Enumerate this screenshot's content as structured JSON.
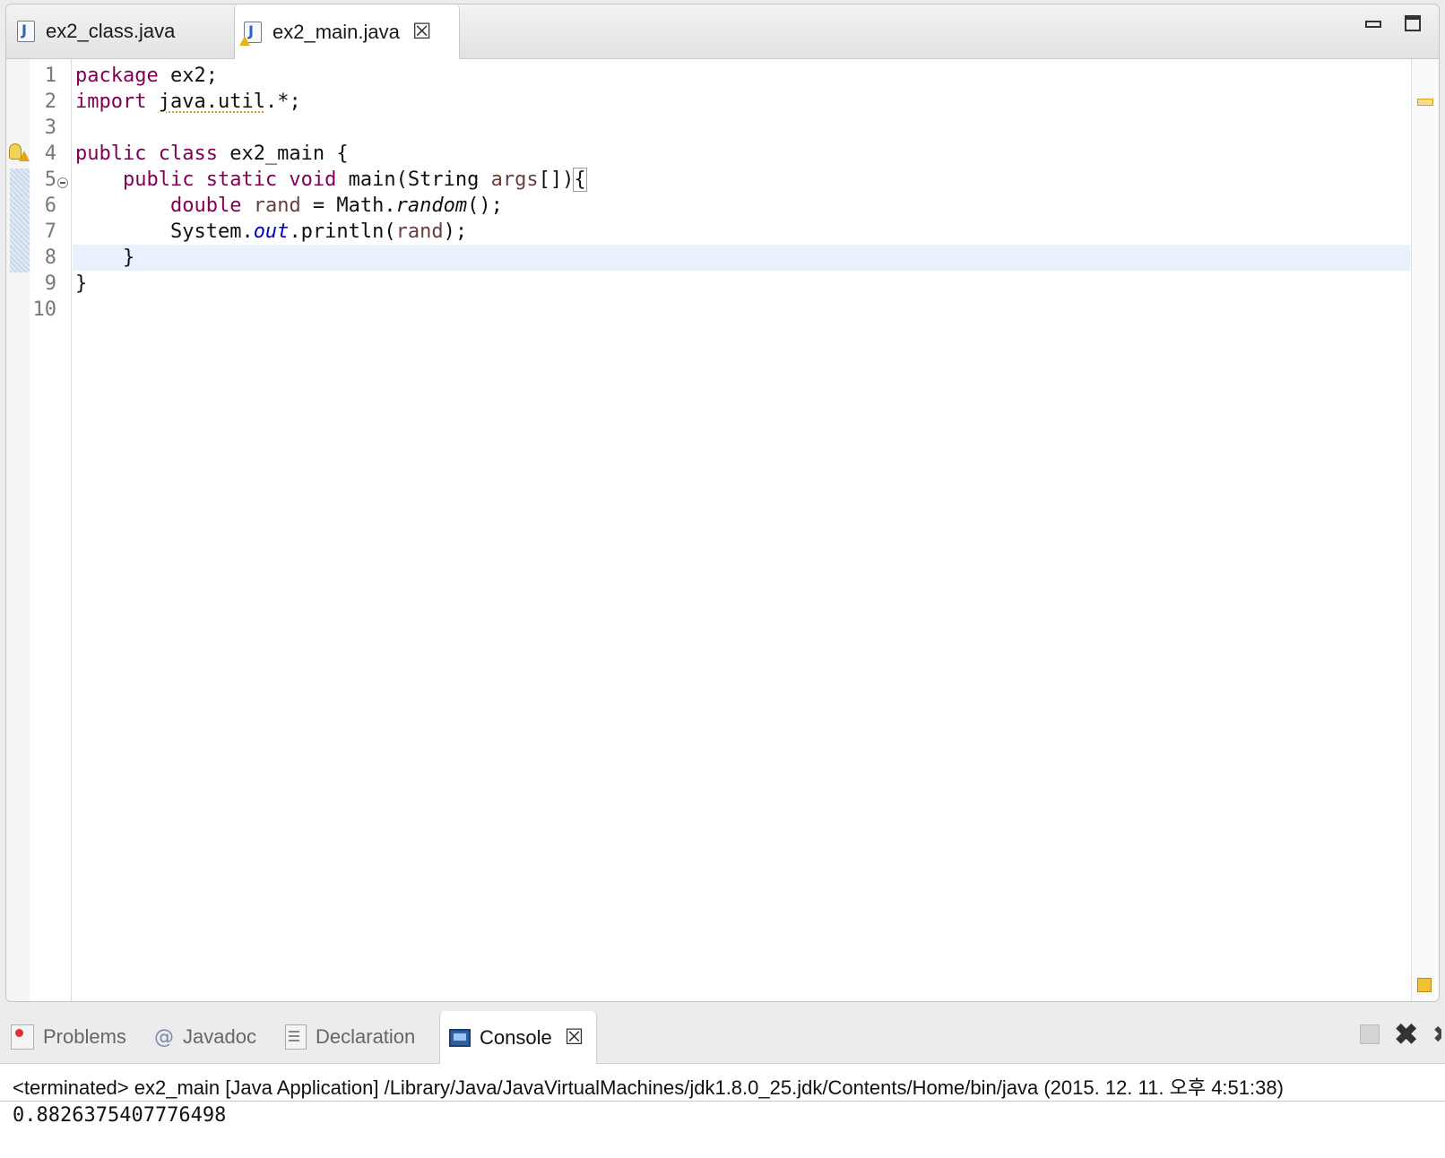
{
  "editor": {
    "tabs": [
      {
        "label": "ex2_class.java",
        "active": false
      },
      {
        "label": "ex2_main.java",
        "active": true,
        "has_warning": true
      }
    ],
    "close_glyph": "☒",
    "line_numbers": [
      "1",
      "2",
      "3",
      "4",
      "5",
      "6",
      "7",
      "8",
      "9",
      "10"
    ],
    "current_line": 8
  },
  "code": {
    "l1_kw": "package",
    "l1_rest": " ex2;",
    "l2_kw": "import",
    "l2_pkg": "java.util",
    "l2_rest": ".*;",
    "l4_kw": "public class",
    "l4_rest": " ex2_main {",
    "l5_indent": "    ",
    "l5_kw": "public static void",
    "l5_mid": " main(String ",
    "l5_var": "args",
    "l5_rest": "[])",
    "l5_brace": "{",
    "l6_indent": "        ",
    "l6_kw": "double",
    "l6_sp": " ",
    "l6_var": "rand",
    "l6_mid": " = Math.",
    "l6_method": "random",
    "l6_rest": "();",
    "l7_indent": "        ",
    "l7_pre": "System.",
    "l7_field": "out",
    "l7_mid": ".println(",
    "l7_var": "rand",
    "l7_rest": ");",
    "l8_text": "    }",
    "l9_text": "}"
  },
  "views": {
    "tabs": [
      {
        "label": "Problems",
        "icon": "problems-icon",
        "active": false
      },
      {
        "label": "Javadoc",
        "icon": "at-sign-icon",
        "active": false
      },
      {
        "label": "Declaration",
        "icon": "declaration-icon",
        "active": false
      },
      {
        "label": "Console",
        "icon": "console-icon",
        "active": true
      }
    ],
    "javadoc_glyph": "@",
    "remove_glyph": "✖",
    "remove_all_glyph": "✖"
  },
  "console": {
    "header": "<terminated> ex2_main [Java Application] /Library/Java/JavaVirtualMachines/jdk1.8.0_25.jdk/Contents/Home/bin/java (2015. 12. 11. 오후 4:51:38)",
    "output": "0.8826375407776498"
  }
}
